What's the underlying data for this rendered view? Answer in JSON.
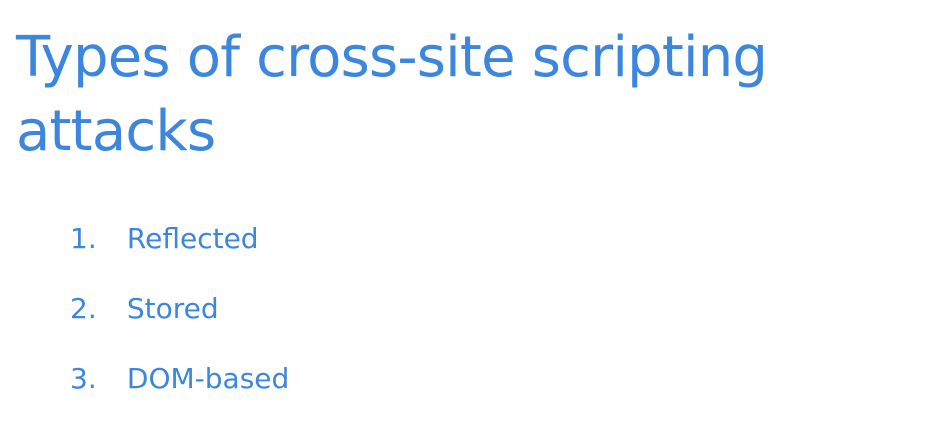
{
  "slide": {
    "title": "Types of cross-site scripting attacks",
    "items": [
      {
        "number": "1.",
        "label": "Reflected"
      },
      {
        "number": "2.",
        "label": "Stored"
      },
      {
        "number": "3.",
        "label": "DOM-based"
      }
    ]
  },
  "colors": {
    "text_accent": "#3c86dd",
    "background": "#ffffff"
  }
}
